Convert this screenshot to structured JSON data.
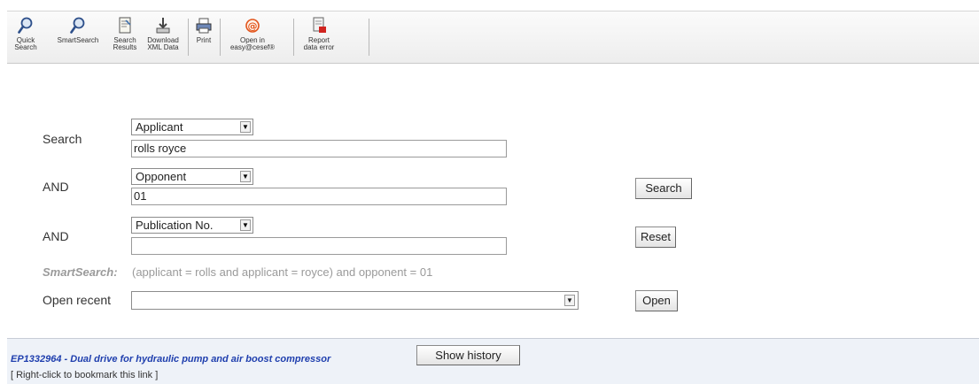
{
  "toolbar": {
    "quick_search": "Quick\nSearch",
    "smart_search": "SmartSearch",
    "search_results": "Search\nResults",
    "download_xml": "Download\nXML Data",
    "print": "Print",
    "open_easy": "Open in\neasy@cesef®",
    "report_error": "Report\ndata error"
  },
  "form": {
    "row1": {
      "label": "Search",
      "field": "Applicant",
      "value": "rolls royce"
    },
    "row2": {
      "label": "AND",
      "field": "Opponent",
      "value": "01"
    },
    "row3": {
      "label": "AND",
      "field": "Publication No.",
      "value": ""
    },
    "search_button": "Search",
    "reset_button": "Reset",
    "smartsearch_label": "SmartSearch:",
    "smartsearch_query": "(applicant = rolls and applicant = royce) and opponent = 01",
    "open_recent_label": "Open recent",
    "open_recent_value": "",
    "open_button": "Open"
  },
  "result": {
    "link": "EP1332964 - Dual drive for hydraulic pump and air boost compressor",
    "show_history": "Show history",
    "bookmark_hint": "[ Right-click to bookmark this link ]"
  },
  "icons": {
    "magnifier": "magnifier-icon",
    "results": "document-icon",
    "download": "download-icon",
    "print": "printer-icon",
    "at": "at-sign-icon",
    "report": "report-icon"
  }
}
